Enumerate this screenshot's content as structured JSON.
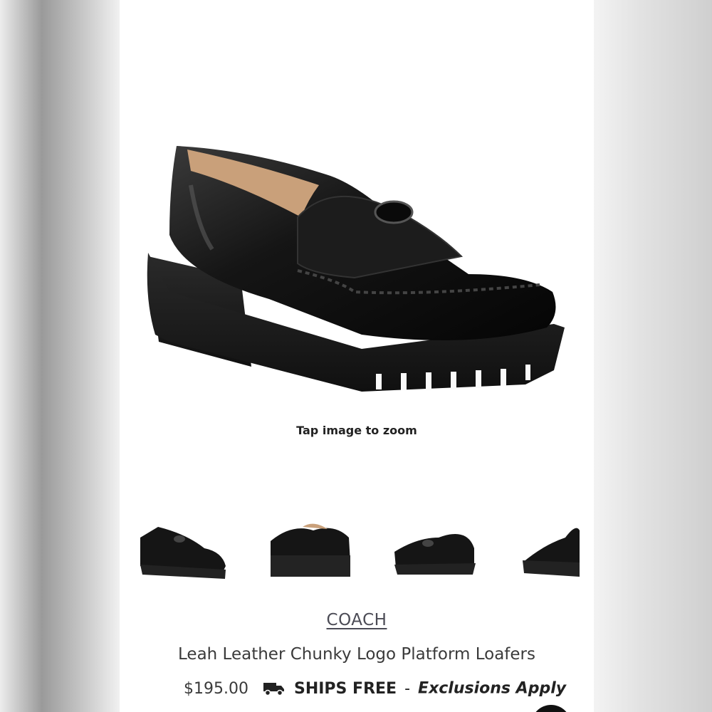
{
  "product": {
    "zoom_hint": "Tap image to zoom",
    "brand": "COACH",
    "title": "Leah Leather Chunky Logo Platform Loafers",
    "price": "$195.00",
    "shipping_label": "SHIPS FREE",
    "shipping_separator": "-",
    "shipping_note": "Exclusions Apply"
  },
  "thumbnails": [
    {
      "icon": "loafer-side-view"
    },
    {
      "icon": "loafer-front-angle"
    },
    {
      "icon": "loafer-inner-side"
    },
    {
      "icon": "loafer-back-angle"
    }
  ],
  "colors": {
    "leather": "#141414",
    "sole": "#1b1b1b",
    "lining": "#c9a07a",
    "page_bg": "#ffffff"
  }
}
